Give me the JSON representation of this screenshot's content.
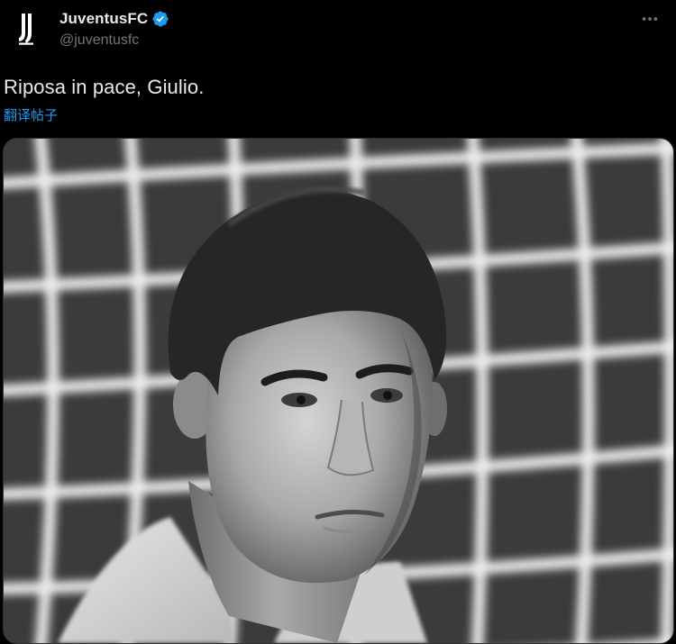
{
  "post": {
    "author": {
      "display_name": "JuventusFC",
      "handle": "@juventusfc",
      "verified": true,
      "avatar_icon": "juventus-logo-icon"
    },
    "more_icon": "more-horizontal-icon",
    "text": "Riposa in pace, Giulio.",
    "translate_label": "翻译帖子",
    "media": {
      "type": "photo",
      "icon": "photo-portrait"
    }
  },
  "colors": {
    "background": "#000000",
    "text_primary": "#e7e9ea",
    "text_secondary": "#71767b",
    "link": "#1d9bf0",
    "verified_badge": "#1d9bf0"
  }
}
